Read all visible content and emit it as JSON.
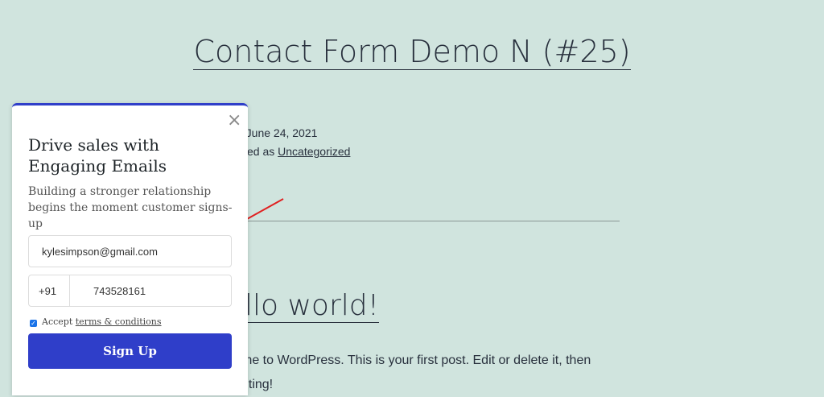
{
  "page": {
    "title": "Contact Form Demo N (#25)",
    "date_text": "d June 24, 2021",
    "category_prefix": "zed as",
    "category_link": "Uncategorized",
    "post_heading": "llo world!",
    "post_text": "me to WordPress. This is your first post. Edit or delete it, then",
    "post_text_line2": "riting!"
  },
  "popup": {
    "title": "Drive sales with Engaging Emails",
    "subtitle": "Building a stronger relationship begins the moment customer signs-up",
    "email_value": "kylesimpson@gmail.com",
    "phone_code": "+91",
    "phone_value": "743528161",
    "consent_prefix": "Accept",
    "consent_link": "terms & conditions",
    "consent_checked": true,
    "signup_label": "Sign Up",
    "close_icon": "close-icon"
  },
  "colors": {
    "background": "#d0e4de",
    "accent": "#2f3ec9",
    "annotation_arrow": "#e02020"
  }
}
